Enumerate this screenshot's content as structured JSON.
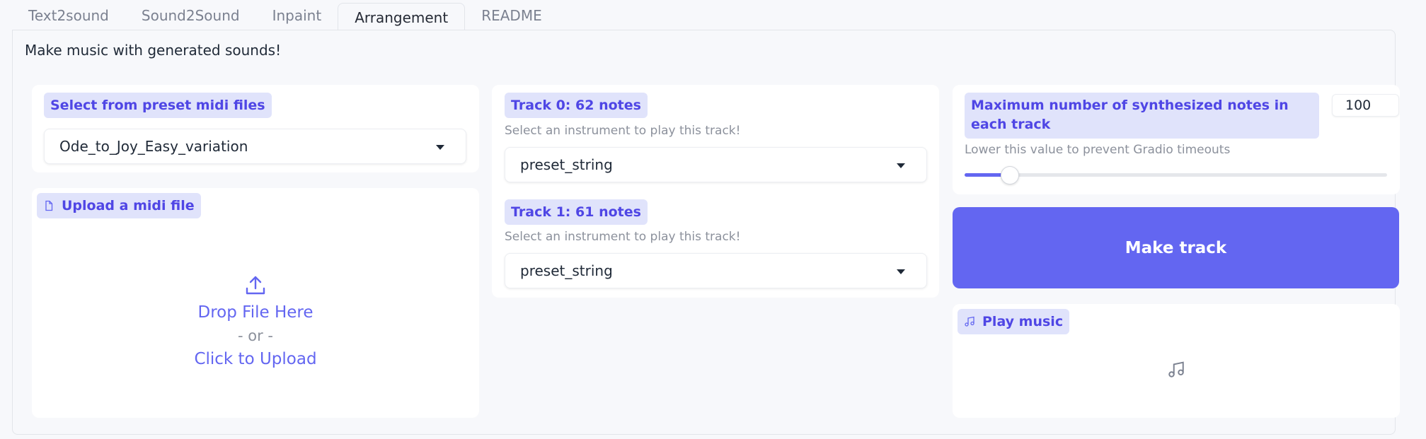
{
  "tabs": [
    {
      "label": "Text2sound",
      "active": false
    },
    {
      "label": "Sound2Sound",
      "active": false
    },
    {
      "label": "Inpaint",
      "active": false
    },
    {
      "label": "Arrangement",
      "active": true
    },
    {
      "label": "README",
      "active": false
    }
  ],
  "intro_text": "Make music with generated sounds!",
  "preset": {
    "label": "Select from preset midi files",
    "selected": "Ode_to_Joy_Easy_variation"
  },
  "upload": {
    "label": "Upload a midi file",
    "icon": "file-icon",
    "drop_text": "Drop File Here",
    "or_text": "- or -",
    "click_text": "Click to Upload",
    "upload_icon": "upload-icon"
  },
  "tracks": [
    {
      "label": "Track 0: 62 notes",
      "hint": "Select an instrument to play this track!",
      "instrument": "preset_string"
    },
    {
      "label": "Track 1: 61 notes",
      "hint": "Select an instrument to play this track!",
      "instrument": "preset_string"
    }
  ],
  "max_notes": {
    "label": "Maximum number of synthesized notes in each track",
    "value": "100",
    "hint": "Lower this value to prevent Gradio timeouts",
    "slider_fraction": 0.108
  },
  "make_track": {
    "label": "Make track"
  },
  "play_music": {
    "label": "Play music",
    "icon": "music-note-icon"
  },
  "colors": {
    "accent": "#6366f1",
    "chip_bg": "#e0e3fb",
    "chip_text": "#4f46e5"
  }
}
